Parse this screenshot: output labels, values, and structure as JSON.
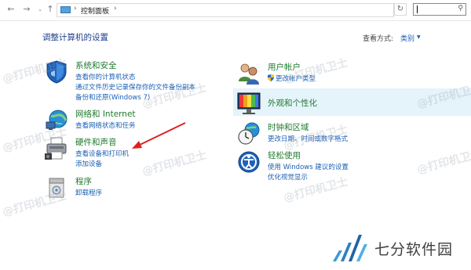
{
  "address_bar": {
    "back_icon": "back-arrow-icon",
    "forward_icon": "forward-arrow-icon",
    "recent_icon": "chevron-down-icon",
    "up_icon": "up-arrow-icon",
    "breadcrumb": "控制面板",
    "refresh_icon": "refresh-icon",
    "search_placeholder": "",
    "search_icon": "search-icon"
  },
  "header": {
    "title": "调整计算机的设置",
    "view_by_label": "查看方式:",
    "view_by_value": "类别"
  },
  "categories_left": [
    {
      "title": "系统和安全",
      "icon": "shield-icon",
      "links": [
        "查看你的计算机状态",
        "通过文件历史记录保存你的文件备份副本",
        "备份和还原(Windows 7)"
      ]
    },
    {
      "title": "网络和 Internet",
      "icon": "network-globe-icon",
      "links": [
        "查看网络状态和任务"
      ]
    },
    {
      "title": "硬件和声音",
      "icon": "printer-icon",
      "links": [
        "查看设备和打印机",
        "添加设备"
      ]
    },
    {
      "title": "程序",
      "icon": "programs-icon",
      "links": [
        "卸载程序"
      ]
    }
  ],
  "categories_right": [
    {
      "title": "用户帐户",
      "icon": "users-icon",
      "links": [
        "更改帐户类型"
      ]
    },
    {
      "title": "外观和个性化",
      "icon": "appearance-icon",
      "links": []
    },
    {
      "title": "时钟和区域",
      "icon": "clock-globe-icon",
      "links": [
        "更改日期、时间或数字格式"
      ]
    },
    {
      "title": "轻松使用",
      "icon": "ease-of-access-icon",
      "links": [
        "使用 Windows 建议的设置",
        "优化视觉显示"
      ]
    }
  ],
  "watermark_text": "@打印机卫士",
  "brand": {
    "name": "七分软件园"
  },
  "colors": {
    "category_title": "#1f7a2f",
    "link": "#1a5fb4",
    "heading": "#1e3f8c",
    "highlight": "#e5f3fb",
    "arrow": "#e02020"
  }
}
